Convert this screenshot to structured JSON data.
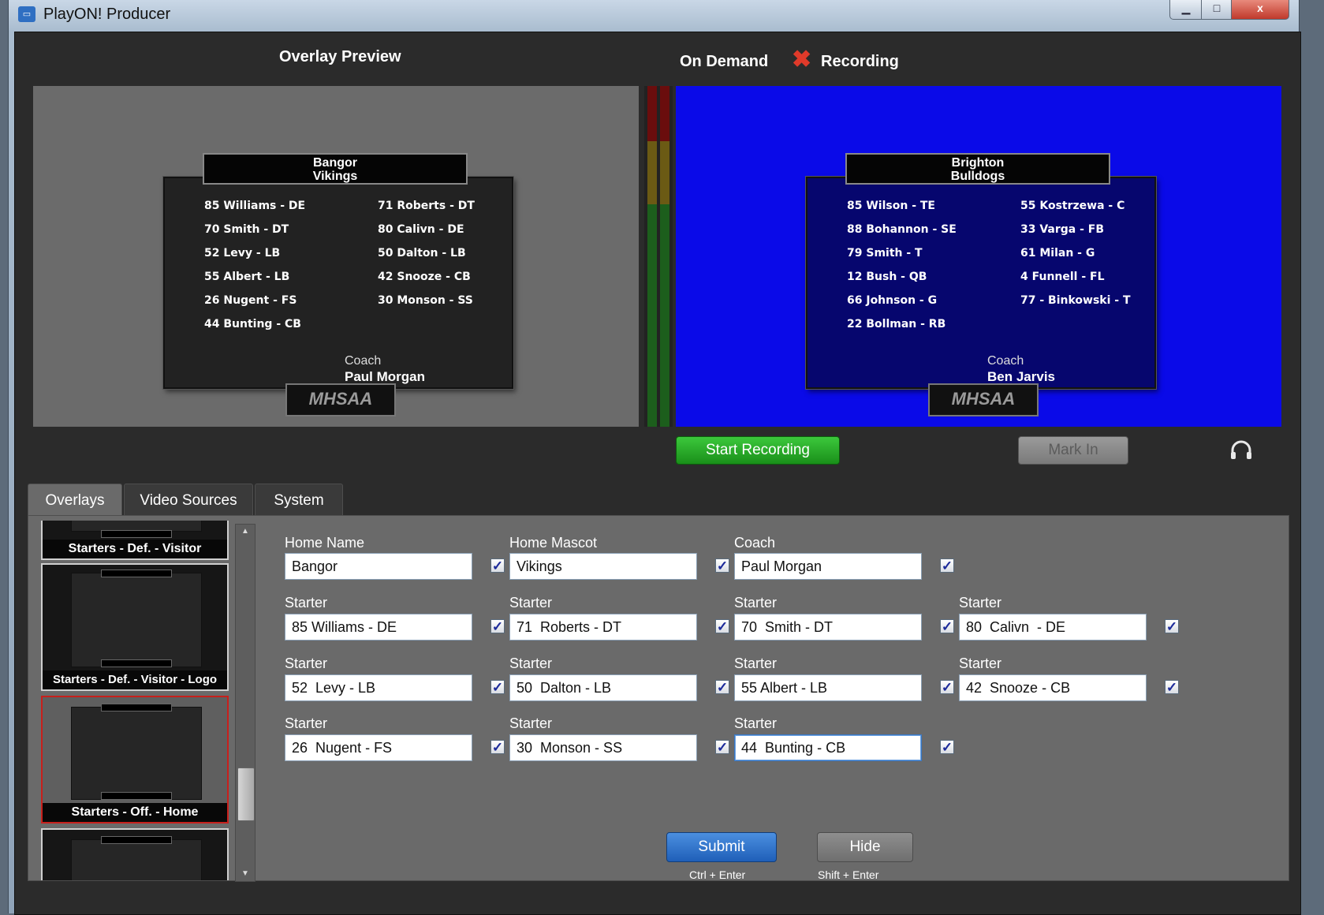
{
  "window": {
    "title": "PlayON! Producer",
    "controls": {
      "minimize": "▁",
      "maximize": "□",
      "close": "x"
    }
  },
  "header": {
    "overlay_preview": "Overlay Preview",
    "on_demand": "On Demand",
    "recording_icon": "x-mark-icon",
    "recording_icon_glyph": "✖",
    "recording": "Recording"
  },
  "preview": {
    "team_line1": "Bangor",
    "team_line2": "Vikings",
    "left_players": [
      "85 Williams - DE",
      "70  Smith - DT",
      "52  Levy - LB",
      "55 Albert - LB",
      "26  Nugent - FS",
      "44  Bunting - CB"
    ],
    "right_players": [
      "71  Roberts - DT",
      "80  Calivn  - DE",
      "50  Dalton - LB",
      "42  Snooze - CB",
      "30  Monson - SS"
    ],
    "coach_label": "Coach",
    "coach_name": "Paul Morgan",
    "logo": "MHSAA"
  },
  "program": {
    "team_line1": "Brighton",
    "team_line2": "Bulldogs",
    "left_players": [
      "85  Wilson - TE",
      "88  Bohannon - SE",
      "79  Smith - T",
      "12  Bush - QB",
      "66  Johnson - G",
      "22  Bollman - RB"
    ],
    "right_players": [
      "55  Kostrzewa - C",
      "33  Varga - FB",
      "61  Milan - G",
      "4  Funnell - FL",
      "77 - Binkowski - T"
    ],
    "coach_label": "Coach",
    "coach_name": "Ben Jarvis",
    "logo": "MHSAA"
  },
  "controls": {
    "start_recording": "Start Recording",
    "mark_in": "Mark In",
    "headphones_icon": "headphones-icon"
  },
  "tabs": [
    {
      "label": "Overlays",
      "active": true
    },
    {
      "label": "Video Sources",
      "active": false
    },
    {
      "label": "System",
      "active": false
    }
  ],
  "thumbnails": [
    {
      "label": "Starters - Def. - Visitor",
      "selected": false
    },
    {
      "label": "Starters - Def. - Visitor - Logo",
      "selected": false
    },
    {
      "label": "Starters - Off. - Home",
      "selected": true
    },
    {
      "label": "",
      "selected": false
    }
  ],
  "form": {
    "check_glyph": "✓",
    "home_name": {
      "label": "Home Name",
      "value": "Bangor",
      "checked": true
    },
    "home_mascot": {
      "label": "Home Mascot",
      "value": "Vikings",
      "checked": true
    },
    "coach": {
      "label": "Coach",
      "value": "Paul Morgan",
      "checked": true
    },
    "starters": [
      {
        "label": "Starter",
        "value": "85 Williams - DE",
        "checked": true
      },
      {
        "label": "Starter",
        "value": "71  Roberts - DT",
        "checked": true
      },
      {
        "label": "Starter",
        "value": "70  Smith - DT",
        "checked": true
      },
      {
        "label": "Starter",
        "value": "80  Calivn  - DE",
        "checked": true
      },
      {
        "label": "Starter",
        "value": "52  Levy - LB",
        "checked": true
      },
      {
        "label": "Starter",
        "value": "50  Dalton - LB",
        "checked": true
      },
      {
        "label": "Starter",
        "value": "55 Albert - LB",
        "checked": true
      },
      {
        "label": "Starter",
        "value": "42  Snooze - CB",
        "checked": true
      },
      {
        "label": "Starter",
        "value": "26  Nugent - FS",
        "checked": true
      },
      {
        "label": "Starter",
        "value": "30  Monson - SS",
        "checked": true
      },
      {
        "label": "Starter",
        "value": "44  Bunting - CB",
        "checked": true
      }
    ],
    "submit": "Submit",
    "submit_hint": "Ctrl + Enter",
    "hide": "Hide",
    "hide_hint": "Shift + Enter"
  },
  "colors": {
    "preview_bg": "#6b6b6b",
    "program_bg": "#0a0ae8",
    "record_green": "#2fb52f",
    "submit_blue": "#2f6fc8",
    "selected_border": "#c8201c"
  }
}
